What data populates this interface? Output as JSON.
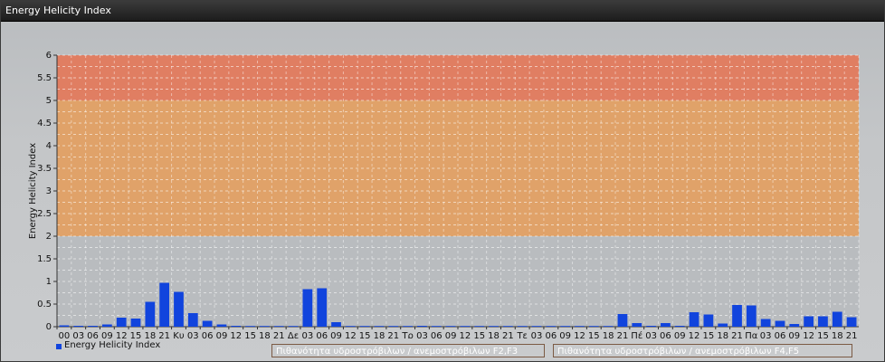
{
  "window": {
    "title": "Energy Helicity Index"
  },
  "colors": {
    "bar": "#1144dd",
    "band_low": "#b9bcbf",
    "band_mid": "#e0a269",
    "band_high": "#e07e62",
    "legend_mid": "#c99168",
    "legend_high": "#c36e5b"
  },
  "chart_data": {
    "type": "bar",
    "ylabel": "Energy Helicity Index",
    "ylim": [
      0,
      6
    ],
    "yticks": [
      "0",
      "0.5",
      "1",
      "1.5",
      "2",
      "2.5",
      "3",
      "3.5",
      "4",
      "4.5",
      "5",
      "5.5",
      "6"
    ],
    "grid": true,
    "legend_position": "bottom-left",
    "categories": [
      "00",
      "03",
      "06",
      "09",
      "12",
      "15",
      "18",
      "21",
      "Κυ",
      "03",
      "06",
      "09",
      "12",
      "15",
      "18",
      "21",
      "Δε",
      "03",
      "06",
      "09",
      "12",
      "15",
      "18",
      "21",
      "Τρ",
      "03",
      "06",
      "09",
      "12",
      "15",
      "18",
      "21",
      "Τε",
      "03",
      "06",
      "09",
      "12",
      "15",
      "18",
      "21",
      "Πέ",
      "03",
      "06",
      "09",
      "12",
      "15",
      "18",
      "21",
      "Πα",
      "03",
      "06",
      "09",
      "12",
      "15",
      "18",
      "21"
    ],
    "series": [
      {
        "name": "Energy Helicity Index",
        "values": [
          0.03,
          0.02,
          0.02,
          0.05,
          0.2,
          0.18,
          0.55,
          0.97,
          0.77,
          0.3,
          0.13,
          0.05,
          0.02,
          0.01,
          0.01,
          0.01,
          0.01,
          0.83,
          0.85,
          0.1,
          0.01,
          0.01,
          0.01,
          0.01,
          0.01,
          0.02,
          0.01,
          0.01,
          0.01,
          0.01,
          0.01,
          0.01,
          0.01,
          0.01,
          0.01,
          0.01,
          0.01,
          0.01,
          0.01,
          0.28,
          0.08,
          0.02,
          0.08,
          0.02,
          0.32,
          0.27,
          0.07,
          0.48,
          0.47,
          0.17,
          0.13,
          0.06,
          0.23,
          0.23,
          0.33,
          0.21
        ]
      }
    ],
    "bands": [
      {
        "from": 2,
        "to": 5,
        "label": "Πιθανότητα υδροστρόβιλων / ανεμοστρόβιλων F2,F3"
      },
      {
        "from": 5,
        "to": 6,
        "label": "Πιθανότητα υδροστρόβιλων / ανεμοστρόβιλων F4,F5"
      }
    ]
  }
}
